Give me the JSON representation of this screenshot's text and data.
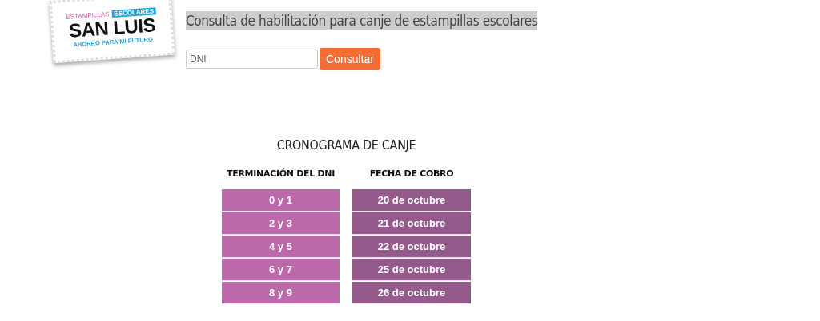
{
  "logo": {
    "top_left": "ESTAMPILLAS",
    "top_right": "ESCOLARES",
    "name": "SAN LUIS",
    "slogan": "AHORRO PARA MI FUTURO"
  },
  "title": "Consulta de habilitación para canje de estampillas escolares",
  "search": {
    "placeholder": "DNI",
    "button": "Consultar"
  },
  "schedule": {
    "title": "CRONOGRAMA DE CANJE",
    "columns": [
      "TERMINACIÓN DEL DNI",
      "FECHA DE COBRO"
    ],
    "rows": [
      [
        "0 y 1",
        "20 de octubre"
      ],
      [
        "2 y 3",
        "21 de octubre"
      ],
      [
        "4 y 5",
        "22 de octubre"
      ],
      [
        "6 y 7",
        "25 de octubre"
      ],
      [
        "8 y 9",
        "26 de octubre"
      ]
    ]
  }
}
